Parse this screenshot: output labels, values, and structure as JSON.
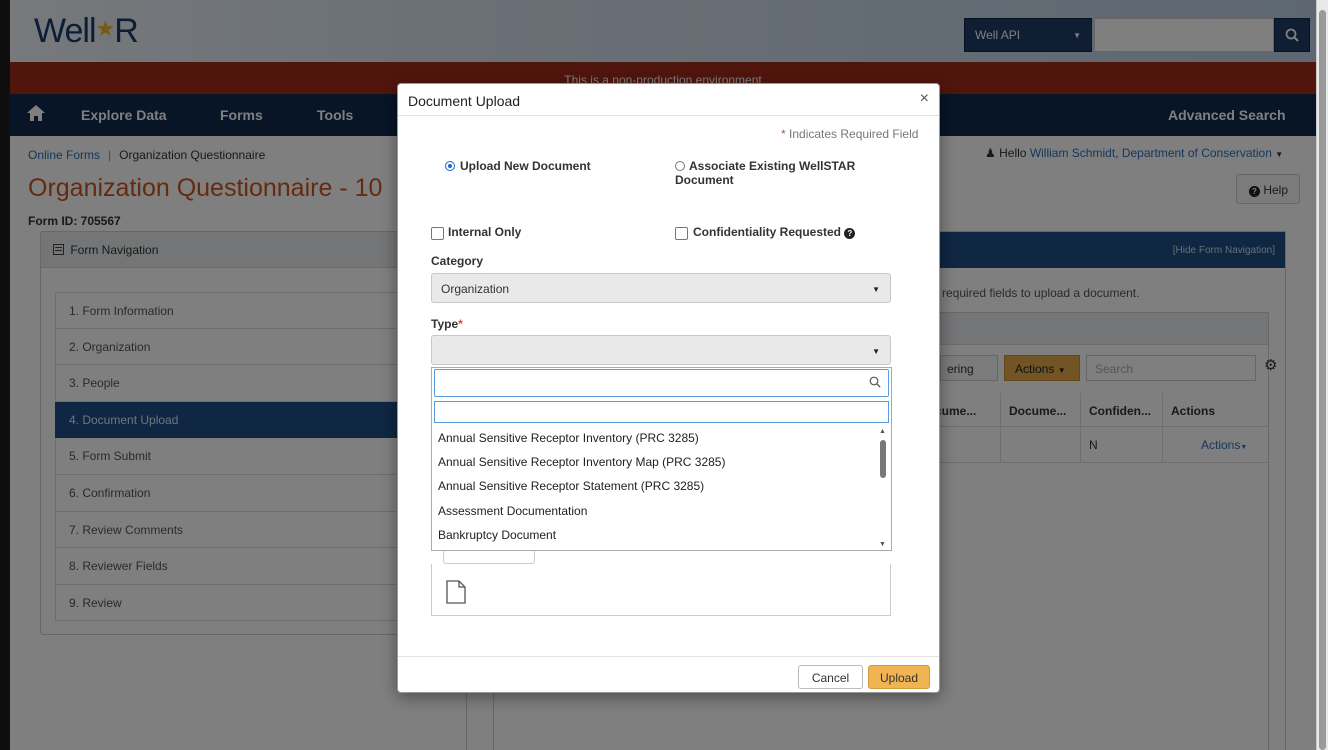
{
  "header": {
    "logo_text": "WellSTAR",
    "api_select": "Well API",
    "api_input_value": "",
    "search_icon": "search-icon"
  },
  "banner": "This is a non-production environment",
  "nav": {
    "items": [
      "Explore Data",
      "Forms",
      "Tools"
    ],
    "advanced_search": "Advanced Search"
  },
  "breadcrumb": {
    "root": "Online Forms",
    "current": "Organization Questionnaire"
  },
  "user": {
    "greeting": "Hello",
    "name": "William Schmidt, Department of Conservation"
  },
  "page_title": "Organization Questionnaire - 10",
  "help_label": "Help",
  "form_id": "Form ID: 705567",
  "form_nav": {
    "title": "Form Navigation",
    "hide_label": "[Hide Form Navigation]",
    "items": [
      "1. Form Information",
      "2. Organization",
      "3. People",
      "4. Document Upload",
      "5. Form Submit",
      "6. Confirmation",
      "7. Review Comments",
      "8. Reviewer Fields",
      "9. Review"
    ],
    "active_index": 3
  },
  "background": {
    "required_hint": "required fields to upload a document.",
    "filter_label": "ering",
    "actions_label": "Actions",
    "search_placeholder": "Search",
    "columns": [
      "cume...",
      "Docume...",
      "Confiden...",
      "Actions"
    ],
    "row": {
      "confidential": "N",
      "actions": "Actions"
    }
  },
  "modal": {
    "title": "Document Upload",
    "close": "×",
    "required_note": "Indicates Required Field",
    "radio_upload": "Upload New Document",
    "radio_associate": "Associate Existing WellSTAR Document",
    "radio_selected": "upload",
    "check_internal": "Internal Only",
    "check_confidential": "Confidentiality Requested",
    "category_label": "Category",
    "category_value": "Organization",
    "type_label": "Type",
    "type_value": "",
    "dropdown": {
      "search_value": "",
      "options": [
        "Annual Sensitive Receptor Inventory (PRC 3285)",
        "Annual Sensitive Receptor Inventory Map (PRC 3285)",
        "Annual Sensitive Receptor Statement (PRC 3285)",
        "Assessment Documentation",
        "Bankruptcy Document"
      ]
    },
    "cancel_label": "Cancel",
    "upload_label": "Upload"
  }
}
